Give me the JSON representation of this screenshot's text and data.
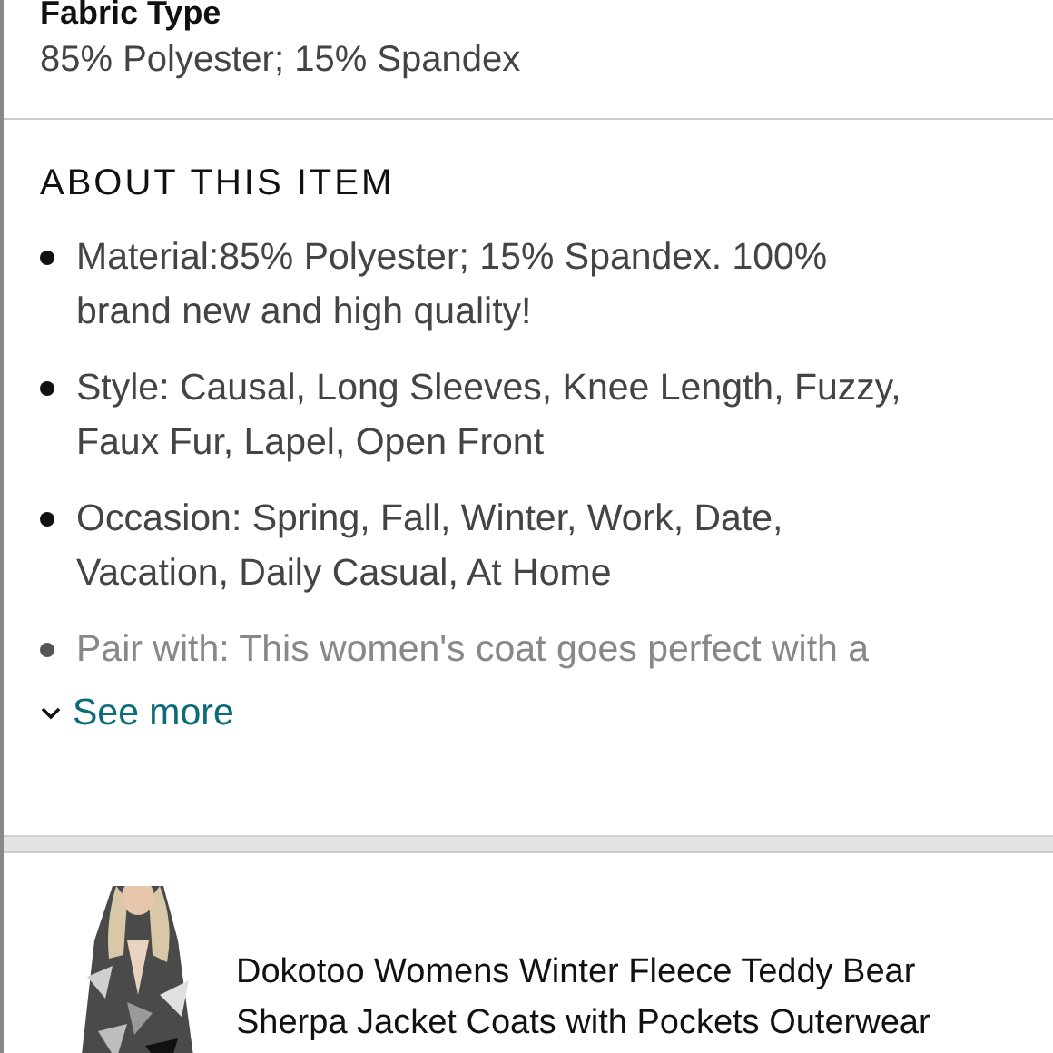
{
  "details": [
    {
      "label": "Fabric Type",
      "value": "85% Polyester; 15% Spandex"
    }
  ],
  "about": {
    "heading": "ABOUT THIS ITEM",
    "bullets": [
      {
        "text": "Material:85% Polyester; 15% Spandex. 100% brand new and high quality!",
        "faded": false
      },
      {
        "text": "Style: Causal, Long Sleeves, Knee Length, Fuzzy, Faux Fur, Lapel, Open Front",
        "faded": false
      },
      {
        "text": "Occasion: Spring, Fall, Winter, Work, Date, Vacation, Daily Casual, At Home",
        "faded": false
      },
      {
        "text": "Pair with: This women's coat goes perfect with a",
        "faded": true
      }
    ],
    "see_more": "See more"
  },
  "related_product": {
    "kind": "picture",
    "title": "Dokotoo Womens Winter Fleece Teddy Bear Sherpa Jacket Coats with Pockets Outerwear"
  }
}
